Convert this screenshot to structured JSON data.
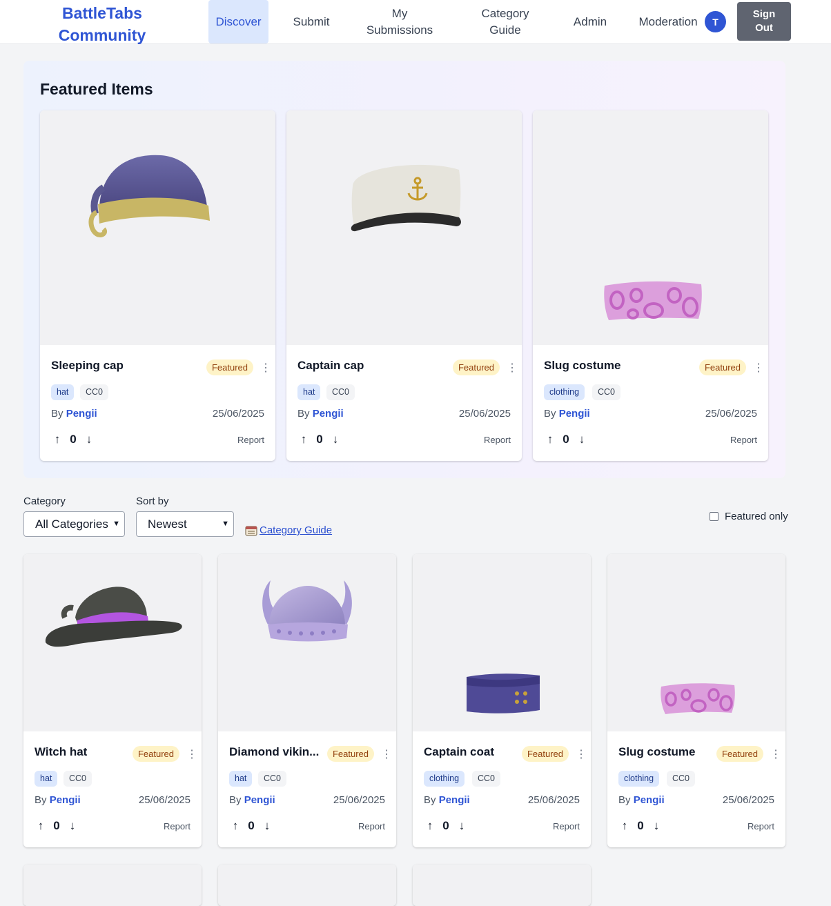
{
  "header": {
    "brand_line1": "BattleTabs",
    "brand_line2": "Community",
    "nav": {
      "discover": "Discover",
      "submit": "Submit",
      "my_submissions_1": "My",
      "my_submissions_2": "Submissions",
      "category_guide_1": "Category",
      "category_guide_2": "Guide",
      "admin": "Admin",
      "moderation": "Moderation"
    },
    "avatar_initial": "T",
    "signout_1": "Sign",
    "signout_2": "Out"
  },
  "featured": {
    "title": "Featured Items",
    "items": [
      {
        "title": "Sleeping cap",
        "badge": "Featured",
        "category": "hat",
        "license": "CC0",
        "by": "By",
        "author": "Pengii",
        "date": "25/06/2025",
        "votes": "0",
        "report": "Report",
        "icon": "sleeping-cap"
      },
      {
        "title": "Captain cap",
        "badge": "Featured",
        "category": "hat",
        "license": "CC0",
        "by": "By",
        "author": "Pengii",
        "date": "25/06/2025",
        "votes": "0",
        "report": "Report",
        "icon": "captain-cap"
      },
      {
        "title": "Slug costume",
        "badge": "Featured",
        "category": "clothing",
        "license": "CC0",
        "by": "By",
        "author": "Pengii",
        "date": "25/06/2025",
        "votes": "0",
        "report": "Report",
        "icon": "slug-costume"
      }
    ]
  },
  "filters": {
    "category_label": "Category",
    "category_value": "All Categories",
    "sort_label": "Sort by",
    "sort_value": "Newest",
    "guide_link": "Category Guide",
    "featured_only": "Featured only"
  },
  "grid": {
    "items": [
      {
        "title": "Witch hat",
        "badge": "Featured",
        "category": "hat",
        "license": "CC0",
        "by": "By",
        "author": "Pengii",
        "date": "25/06/2025",
        "votes": "0",
        "report": "Report",
        "icon": "witch-hat"
      },
      {
        "title": "Diamond vikin...",
        "badge": "Featured",
        "category": "hat",
        "license": "CC0",
        "by": "By",
        "author": "Pengii",
        "date": "25/06/2025",
        "votes": "0",
        "report": "Report",
        "icon": "viking-helmet"
      },
      {
        "title": "Captain coat",
        "badge": "Featured",
        "category": "clothing",
        "license": "CC0",
        "by": "By",
        "author": "Pengii",
        "date": "25/06/2025",
        "votes": "0",
        "report": "Report",
        "icon": "captain-coat"
      },
      {
        "title": "Slug costume",
        "badge": "Featured",
        "category": "clothing",
        "license": "CC0",
        "by": "By",
        "author": "Pengii",
        "date": "25/06/2025",
        "votes": "0",
        "report": "Report",
        "icon": "slug-costume"
      }
    ]
  },
  "icons": {
    "upvote": "arrow-up-icon",
    "downvote": "arrow-down-icon",
    "menu": "kebab-menu-icon",
    "calendar": "calendar-icon",
    "select": "chevron-down-icon"
  },
  "colors": {
    "accent": "#2f55d4",
    "featured_badge_bg": "#fef3c7",
    "category_tag_bg": "#dbe7fd"
  }
}
